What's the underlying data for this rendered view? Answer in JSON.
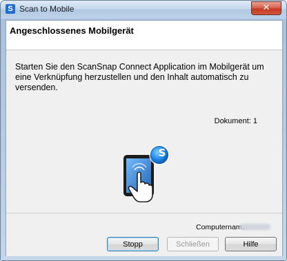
{
  "window": {
    "title": "Scan to Mobile",
    "app_icon_glyph": "S",
    "close_glyph": "✕"
  },
  "header": {
    "title": "Angeschlossenes Mobilgerät"
  },
  "main": {
    "message": "Starten Sie den ScanSnap Connect Application im Mobilgerät um eine Verknüpfung herzustellen und den Inhalt automatisch zu versenden.",
    "document_count": "Dokument: 1",
    "illustration_icon": "tablet-touch-icon",
    "badge_glyph": "S"
  },
  "footer": {
    "computer_name_label": "Computername:",
    "computer_name_value": "",
    "buttons": {
      "stop": "Stopp",
      "close": "Schließen",
      "help": "Hilfe"
    }
  },
  "colors": {
    "accent_blue": "#1f6fd2",
    "close_red": "#c33a22"
  }
}
